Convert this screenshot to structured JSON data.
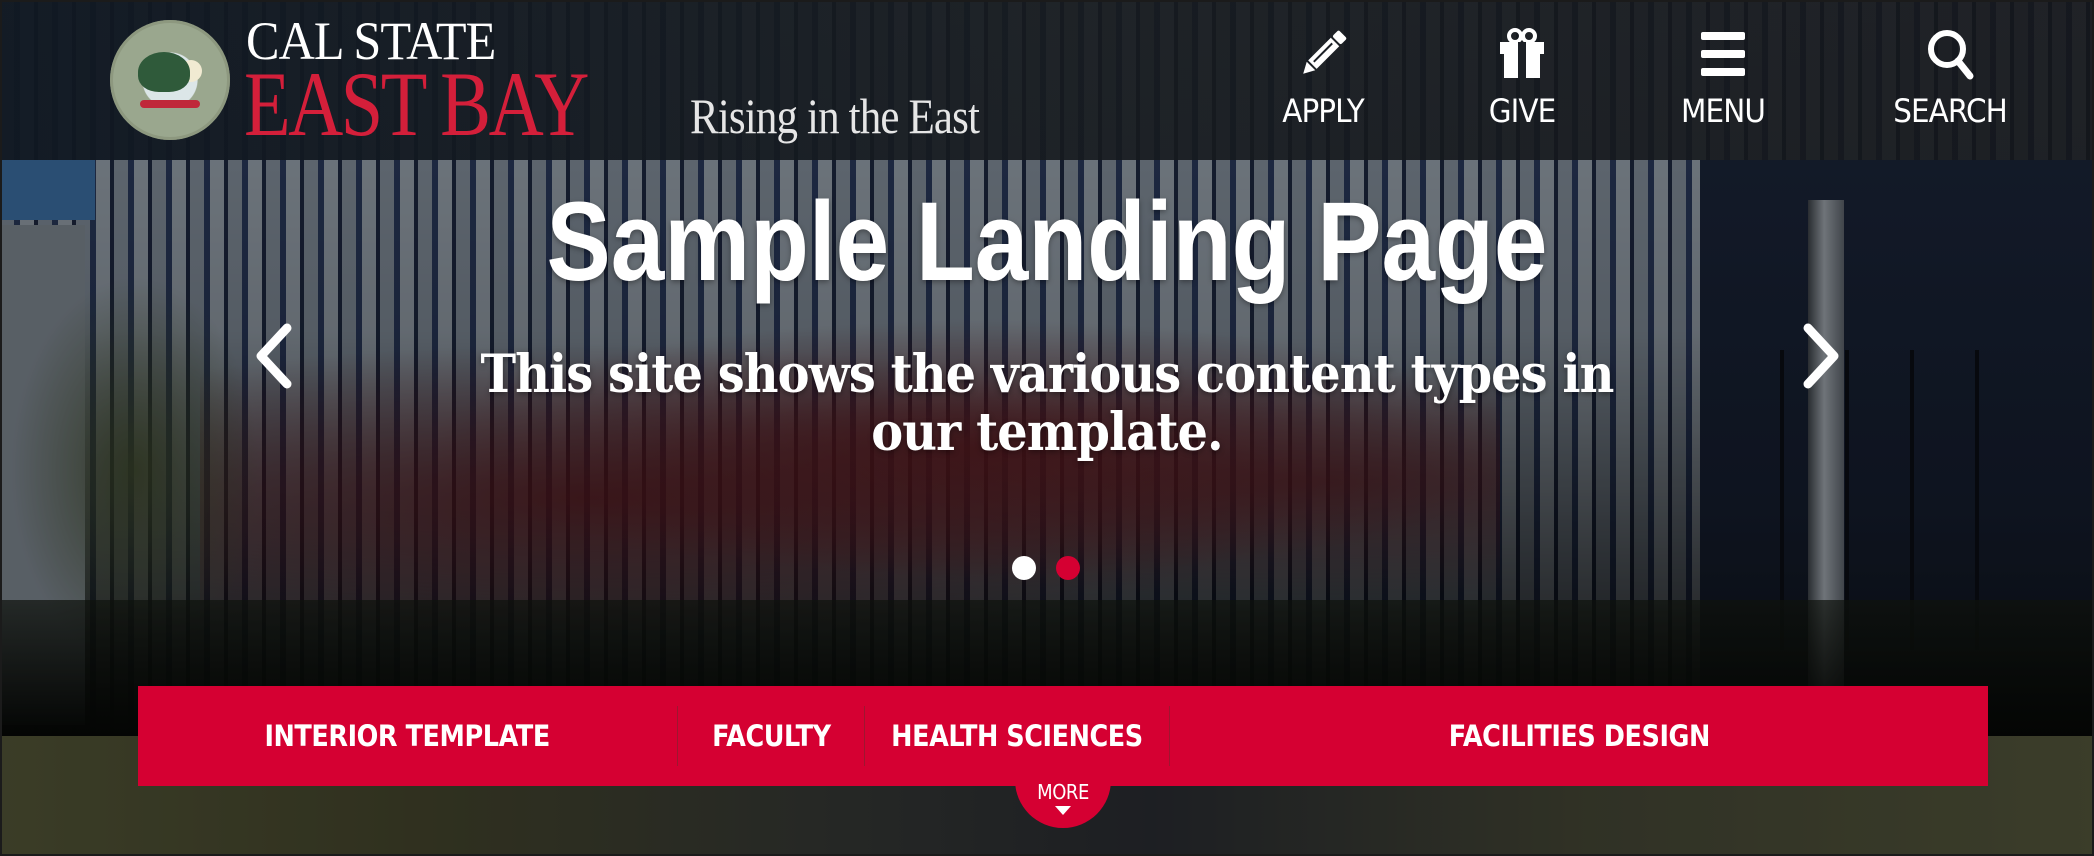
{
  "header": {
    "brand_line1": "CAL STATE",
    "brand_line2": "EAST BAY",
    "tagline": "Rising in the East",
    "seal_icon": "university-seal",
    "utility_links": [
      {
        "label": "APPLY",
        "icon": "pencil-icon"
      },
      {
        "label": "GIVE",
        "icon": "gift-icon"
      },
      {
        "label": "MENU",
        "icon": "hamburger-menu-icon"
      },
      {
        "label": "SEARCH",
        "icon": "search-icon"
      }
    ]
  },
  "hero": {
    "title": "Sample Landing Page",
    "subtitle": "This site shows the various content types in our template.",
    "prev_icon": "chevron-left-icon",
    "next_icon": "chevron-right-icon",
    "slides_total": 2,
    "active_slide": 2,
    "dot_inactive_color": "#ffffff",
    "dot_active_color": "#d50032"
  },
  "quick_nav": {
    "items": [
      {
        "label": "INTERIOR TEMPLATE"
      },
      {
        "label": "FACULTY"
      },
      {
        "label": "HEALTH SCIENCES"
      },
      {
        "label": "FACILITIES DESIGN"
      }
    ],
    "more_label": "MORE",
    "more_icon": "caret-down-icon"
  },
  "colors": {
    "brand_red": "#d50032",
    "logo_red": "#d41f3a",
    "header_bg": "#141c24",
    "text_white": "#ffffff"
  }
}
